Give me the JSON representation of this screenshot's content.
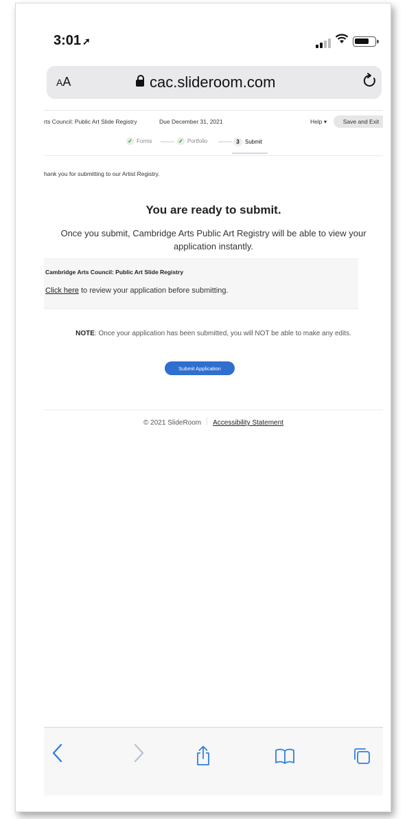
{
  "status_bar": {
    "time": "3:01",
    "location_arrow": "location-arrow-icon"
  },
  "address_bar": {
    "text_size_label": "AA",
    "url": "cac.slideroom.com"
  },
  "page_header": {
    "title": "rts Council: Public Art Slide Registry",
    "due": "Due December 31, 2021",
    "help": "Help ▾",
    "save_exit": "Save and Exit"
  },
  "steps": [
    {
      "label": "Forms",
      "state": "done"
    },
    {
      "label": "Portfolio",
      "state": "done"
    },
    {
      "number": "3",
      "label": "Submit",
      "state": "active"
    }
  ],
  "content": {
    "thanks": "hank you for submitting to our Artist Registry.",
    "heading": "You are ready to submit.",
    "description": "Once you submit, Cambridge Arts Public Art Registry will be able to view your application instantly.",
    "card_title": "Cambridge Arts Council: Public Art Slide Registry",
    "review_link": "Click here",
    "review_text": " to review your application before submitting.",
    "note_label": "NOTE",
    "note_text": ": Once your application has been submitted, you will NOT be able to make any edits.",
    "submit_button": "Submit Application"
  },
  "footer": {
    "copyright": "© 2021 SlideRoom",
    "accessibility": "Accessibility Statement"
  },
  "colors": {
    "primary": "#2f6fcf",
    "ios_blue": "#2f7fe0",
    "check_green": "#2e8b3c"
  }
}
